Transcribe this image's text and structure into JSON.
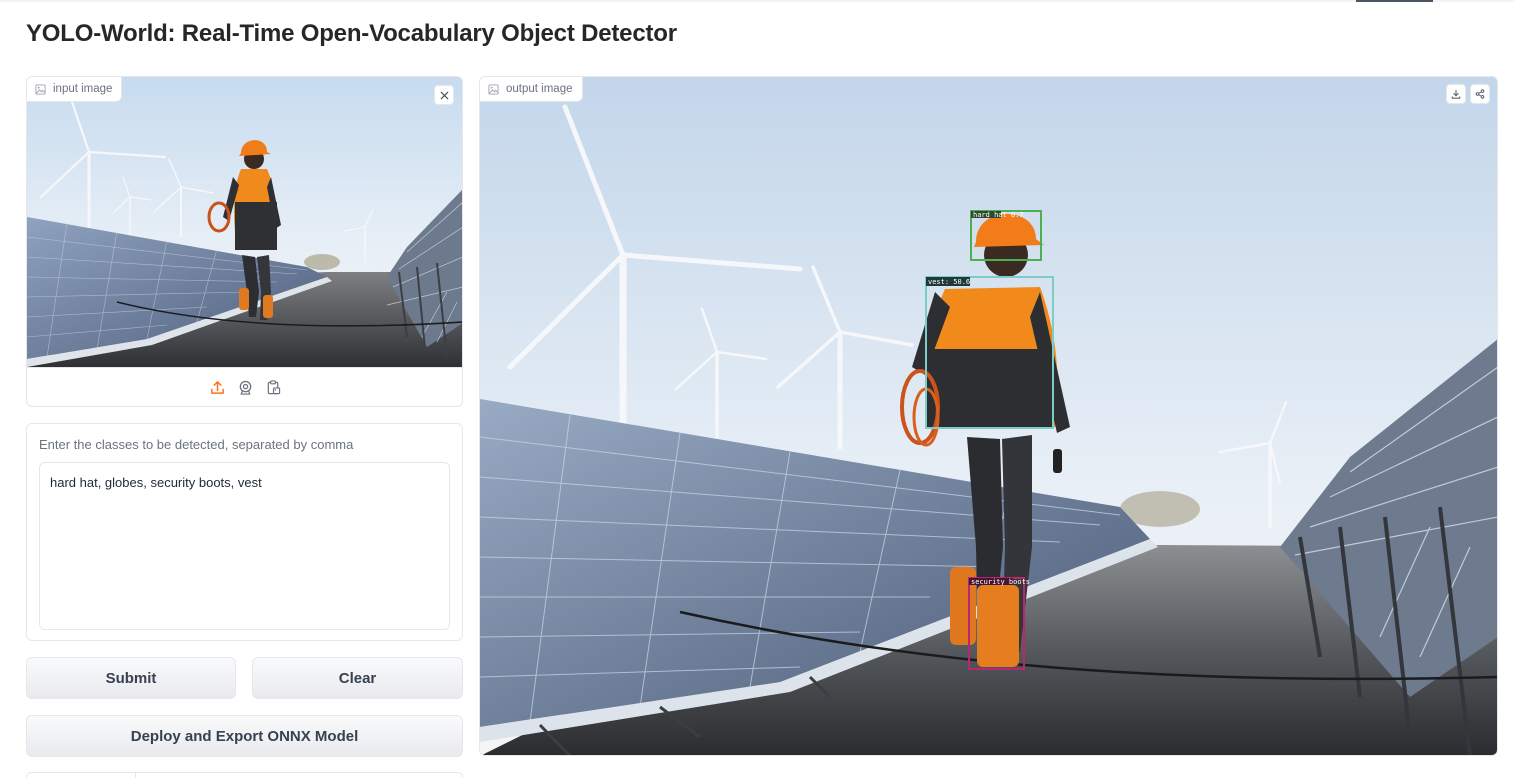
{
  "app": {
    "title": "YOLO-World: Real-Time Open-Vocabulary Object Detector"
  },
  "input_image": {
    "label": "input image",
    "icons": {
      "label": "image-icon",
      "clear": "close-icon",
      "sources": [
        "upload-icon",
        "webcam-icon",
        "clipboard-icon"
      ]
    }
  },
  "classes_textbox": {
    "label": "Enter the classes to be detected, separated by comma",
    "value": "hard hat, globes, security boots, vest"
  },
  "buttons": {
    "submit": "Submit",
    "clear": "Clear",
    "deploy": "Deploy and Export ONNX Model"
  },
  "output_image": {
    "label": "output image",
    "icons": [
      "image-icon",
      "download-icon",
      "share-icon"
    ],
    "detections": [
      {
        "label": "hard hat 0.7",
        "color": "#4caf50"
      },
      {
        "label": "vest: 50.6",
        "color": "#7ccdc8"
      },
      {
        "label": "security boots",
        "color": "#b8286f"
      }
    ]
  },
  "colors": {
    "accent": "#f97316",
    "border": "#e5e7eb",
    "button_text": "#374151"
  }
}
